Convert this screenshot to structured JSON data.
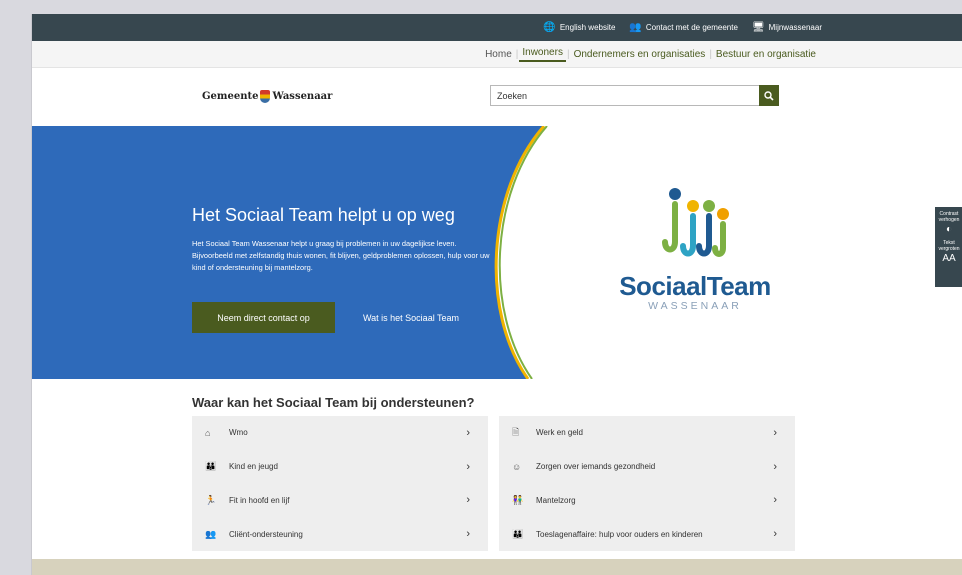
{
  "utility": {
    "links": [
      {
        "icon": "globe-icon",
        "glyph": "🌐",
        "label": "English website"
      },
      {
        "icon": "people-icon",
        "glyph": "👥",
        "label": "Contact met de gemeente"
      },
      {
        "icon": "monitor-icon",
        "glyph": "🖥",
        "label": "Mijnwassenaar"
      }
    ]
  },
  "nav": {
    "home": "Home",
    "inwoners": "Inwoners",
    "ondernemers": "Ondernemers en organisaties",
    "bestuur": "Bestuur en organisatie",
    "sep": "|"
  },
  "header": {
    "logo_text_a": "Gemeente",
    "logo_text_b": "Wassenaar",
    "search_placeholder": "Zoeken"
  },
  "hero": {
    "title": "Het Sociaal Team helpt u op weg",
    "text": "Het Sociaal Team Wassenaar helpt u graag bij problemen in uw dagelijkse leven. Bijvoorbeeld met zelfstandig thuis wonen, fit blijven, geldproblemen oplossen, hulp voor uw kind of ondersteuning bij mantelzorg.",
    "cta_primary": "Neem direct contact op",
    "cta_secondary": "Wat is het Sociaal Team",
    "brand_name": "SociaalTeam",
    "brand_sub": "WASSENAAR"
  },
  "side_widget": {
    "contrast_label": "Contrast verhogen",
    "text_label": "Tekst vergroten",
    "text_glyph": "AA"
  },
  "section": {
    "title": "Waar kan het Sociaal Team bij ondersteunen?"
  },
  "topics_left": [
    {
      "icon": "home-care-icon",
      "glyph": "⌂",
      "label": "Wmo"
    },
    {
      "icon": "parent-child-icon",
      "glyph": "👪",
      "label": "Kind en jeugd"
    },
    {
      "icon": "running-person-icon",
      "glyph": "🏃",
      "label": "Fit in hoofd en lijf"
    },
    {
      "icon": "group-icon",
      "glyph": "👥",
      "label": "Cliënt-ondersteuning"
    }
  ],
  "topics_right": [
    {
      "icon": "document-money-icon",
      "glyph": "🗎",
      "label": "Werk en geld"
    },
    {
      "icon": "head-care-icon",
      "glyph": "☺",
      "label": "Zorgen over iemands gezondheid"
    },
    {
      "icon": "caregiver-icon",
      "glyph": "👫",
      "label": "Mantelzorg"
    },
    {
      "icon": "family-icon",
      "glyph": "👪",
      "label": "Toeslagenaffaire: hulp voor ouders en kinderen"
    }
  ],
  "chevron": "›",
  "colors": {
    "hero_blue": "#2e6aba",
    "accent_green": "#4a5b1f",
    "utility_bg": "#37474f",
    "brand_blue": "#1f5a91"
  }
}
